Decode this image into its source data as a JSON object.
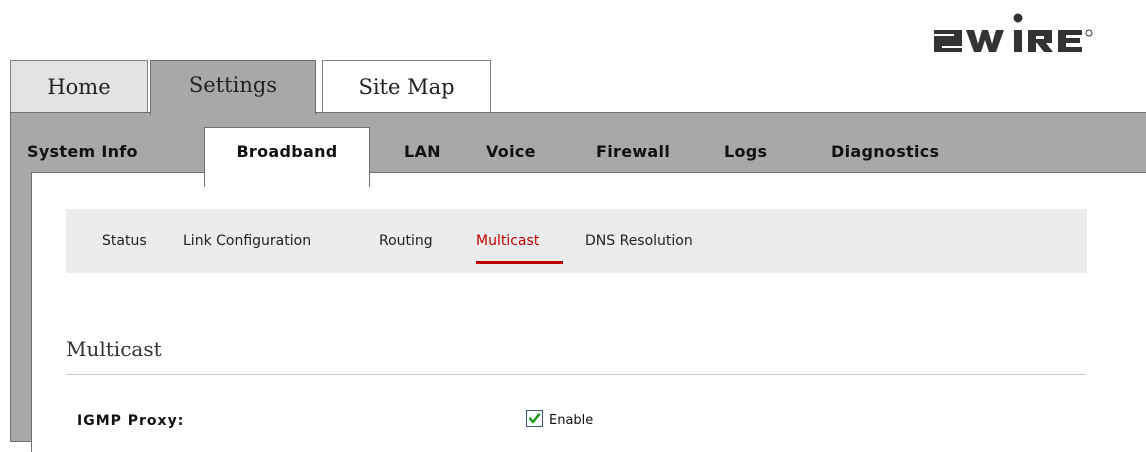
{
  "brand": {
    "logo_text": "2WIRE"
  },
  "top_tabs": [
    {
      "label": "Home"
    },
    {
      "label": "Settings"
    },
    {
      "label": "Site Map"
    }
  ],
  "sub_tabs": [
    {
      "label": "System Info"
    },
    {
      "label": "Broadband"
    },
    {
      "label": "LAN"
    },
    {
      "label": "Voice"
    },
    {
      "label": "Firewall"
    },
    {
      "label": "Logs"
    },
    {
      "label": "Diagnostics"
    }
  ],
  "active_sub_tab": "Broadband",
  "subnav": [
    {
      "label": "Status"
    },
    {
      "label": "Link Configuration"
    },
    {
      "label": "Routing"
    },
    {
      "label": "Multicast"
    },
    {
      "label": "DNS Resolution"
    }
  ],
  "active_subnav": "Multicast",
  "section": {
    "title": "Multicast"
  },
  "igmp": {
    "label": "IGMP Proxy:",
    "checkbox_label": "Enable",
    "checked": true
  },
  "colors": {
    "accent_red": "#c00000",
    "tab_gray": "#a8a8a8"
  }
}
